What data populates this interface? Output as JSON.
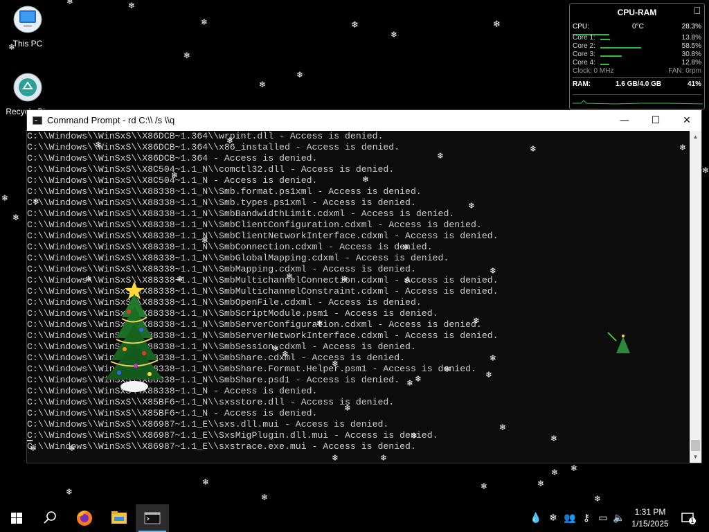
{
  "desktop": {
    "icons": [
      {
        "label": "This PC",
        "icon": "this-pc-icon"
      },
      {
        "label": "Recycle Bin",
        "icon": "recycle-bin-icon"
      }
    ]
  },
  "gadget": {
    "title": "CPU-RAM",
    "cpu_label": "CPU:",
    "temp": "0°C",
    "cpu_percent": "28.3%",
    "cpu_fill": 0.283,
    "cores": [
      {
        "label": "Core 1:",
        "value": "13.8%",
        "fill": 0.138
      },
      {
        "label": "Core 2:",
        "value": "58.5%",
        "fill": 0.585
      },
      {
        "label": "Core 3:",
        "value": "30.8%",
        "fill": 0.308
      },
      {
        "label": "Core 4:",
        "value": "12.8%",
        "fill": 0.128
      }
    ],
    "clock": "Clock: 0 MHz",
    "fan": "FAN: 0rpm",
    "ram_label": "RAM:",
    "ram_usage": "1.6 GB/4.0 GB",
    "ram_percent": "41%",
    "accent": "#2fbf3e"
  },
  "window": {
    "title": "Command Prompt - rd  C:\\\\ /s \\\\q",
    "minimize": "—",
    "maximize": "☐",
    "close": "✕",
    "lines": [
      "C:\\\\Windows\\\\WinSxS\\\\X86DCB~1.364\\\\wrpint.dll - Access is denied.",
      "C:\\\\Windows\\\\WinSxS\\\\X86DCB~1.364\\\\x86_installed - Access is denied.",
      "C:\\\\Windows\\\\WinSxS\\\\X86DCB~1.364 - Access is denied.",
      "C:\\\\Windows\\\\WinSxS\\\\X8C504~1.1_N\\\\comctl32.dll - Access is denied.",
      "C:\\\\Windows\\\\WinSxS\\\\X8C504~1.1_N - Access is denied.",
      "C:\\\\Windows\\\\WinSxS\\\\X88338~1.1_N\\\\Smb.format.ps1xml - Access is denied.",
      "C:\\\\Windows\\\\WinSxS\\\\X88338~1.1_N\\\\Smb.types.ps1xml - Access is denied.",
      "C:\\\\Windows\\\\WinSxS\\\\X88338~1.1_N\\\\SmbBandwidthLimit.cdxml - Access is denied.",
      "C:\\\\Windows\\\\WinSxS\\\\X88338~1.1_N\\\\SmbClientConfiguration.cdxml - Access is denied.",
      "C:\\\\Windows\\\\WinSxS\\\\X88338~1.1_N\\\\SmbClientNetworkInterface.cdxml - Access is denied.",
      "C:\\\\Windows\\\\WinSxS\\\\X88338~1.1_N\\\\SmbConnection.cdxml - Access is denied.",
      "C:\\\\Windows\\\\WinSxS\\\\X88338~1.1_N\\\\SmbGlobalMapping.cdxml - Access is denied.",
      "C:\\\\Windows\\\\WinSxS\\\\X88338~1.1_N\\\\SmbMapping.cdxml - Access is denied.",
      "C:\\\\Windows\\\\WinSxS\\\\X88338~1.1_N\\\\SmbMultichannelConnection.cdxml - Access is denied.",
      "C:\\\\Windows\\\\WinSxS\\\\X88338~1.1_N\\\\SmbMultichannelConstraint.cdxml - Access is denied.",
      "C:\\\\Windows\\\\WinSxS\\\\X88338~1.1_N\\\\SmbOpenFile.cdxml - Access is denied.",
      "C:\\\\Windows\\\\WinSxS\\\\X88338~1.1_N\\\\SmbScriptModule.psm1 - Access is denied.",
      "C:\\\\Windows\\\\WinSxS\\\\X88338~1.1_N\\\\SmbServerConfiguration.cdxml - Access is denied.",
      "C:\\\\Windows\\\\WinSxS\\\\X88338~1.1_N\\\\SmbServerNetworkInterface.cdxml - Access is denied.",
      "C:\\\\Windows\\\\WinSxS\\\\X88338~1.1_N\\\\SmbSession.cdxml - Access is denied.",
      "C:\\\\Windows\\\\WinSxS\\\\X88338~1.1_N\\\\SmbShare.cdxml - Access is denied.",
      "C:\\\\Windows\\\\WinSxS\\\\X88338~1.1_N\\\\SmbShare.Format.Helper.psm1 - Access is denied.",
      "C:\\\\Windows\\\\WinSxS\\\\X88338~1.1_N\\\\SmbShare.psd1 - Access is denied.",
      "C:\\\\Windows\\\\WinSxS\\\\X88338~1.1_N - Access is denied.",
      "C:\\\\Windows\\\\WinSxS\\\\X85BF6~1.1_N\\\\sxsstore.dll - Access is denied.",
      "C:\\\\Windows\\\\WinSxS\\\\X85BF6~1.1_N - Access is denied.",
      "C:\\\\Windows\\\\WinSxS\\\\X86987~1.1_E\\\\sxs.dll.mui - Access is denied.",
      "C:\\\\Windows\\\\WinSxS\\\\X86987~1.1_E\\\\SxsMigPlugin.dll.mui - Access is denied.",
      "C:\\\\Windows\\\\WinSxS\\\\X86987~1.1_E\\\\sxstrace.exe.mui - Access is denied."
    ]
  },
  "taskbar": {
    "items": [
      {
        "icon": "windows-start-icon"
      },
      {
        "icon": "search-icon"
      },
      {
        "icon": "firefox-icon"
      },
      {
        "icon": "file-explorer-icon"
      },
      {
        "icon": "command-prompt-icon",
        "active": true
      }
    ],
    "tray_icons": [
      "water-drop-icon",
      "snowflake-icon",
      "people-icon",
      "key-icon",
      "network-icon",
      "volume-icon"
    ],
    "time": "1:31 PM",
    "date": "1/15/2025",
    "notification_count": "1"
  }
}
